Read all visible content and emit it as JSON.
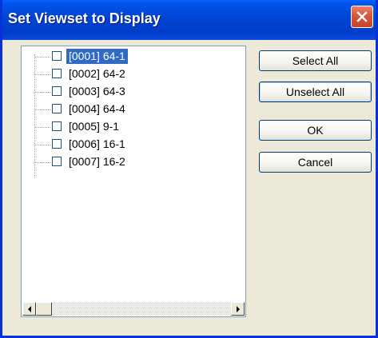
{
  "window": {
    "title": "Set Viewset to Display"
  },
  "tree": {
    "items": [
      {
        "label": "[0001] 64-1",
        "checked": false,
        "selected": true
      },
      {
        "label": "[0002] 64-2",
        "checked": false,
        "selected": false
      },
      {
        "label": "[0003] 64-3",
        "checked": false,
        "selected": false
      },
      {
        "label": "[0004] 64-4",
        "checked": false,
        "selected": false
      },
      {
        "label": "[0005] 9-1",
        "checked": false,
        "selected": false
      },
      {
        "label": "[0006] 16-1",
        "checked": false,
        "selected": false
      },
      {
        "label": "[0007] 16-2",
        "checked": false,
        "selected": false
      }
    ]
  },
  "buttons": {
    "select_all": "Select All",
    "unselect_all": "Unselect All",
    "ok": "OK",
    "cancel": "Cancel"
  },
  "icons": {
    "close": "close-icon",
    "scroll_left": "arrow-left-icon",
    "scroll_right": "arrow-right-icon"
  },
  "colors": {
    "title_bar": "#0046d8",
    "selection": "#316ac5",
    "close_button": "#d4583c",
    "dialog_face": "#ece9d8"
  }
}
